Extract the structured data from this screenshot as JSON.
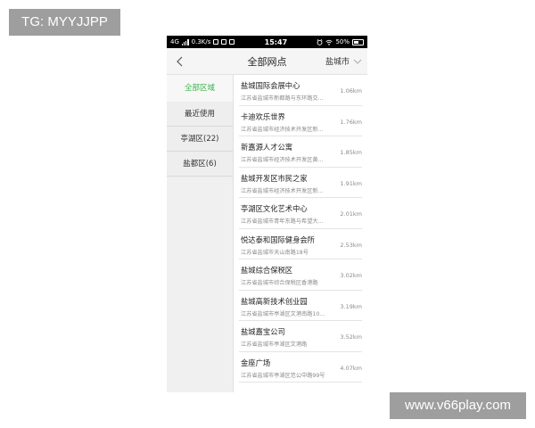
{
  "watermarks": {
    "top": "TG: MYYJJPP",
    "bottom": "www.v66play.com"
  },
  "statusbar": {
    "network": "4G",
    "speed": "0.3K/s",
    "time": "15:47",
    "battery": "50%"
  },
  "navbar": {
    "title": "全部网点",
    "city": "盐城市"
  },
  "sidebar": {
    "items": [
      {
        "label": "全部区域"
      },
      {
        "label": "最近使用"
      },
      {
        "label": "亭湖区(22)"
      },
      {
        "label": "盐都区(6)"
      }
    ]
  },
  "list": {
    "rows": [
      {
        "name": "盐城国际会展中心",
        "address": "江苏省盐城市新都路与东环路交...",
        "distance": "1.06km"
      },
      {
        "name": "卡迪欢乐世界",
        "address": "江苏省盐城市经济技术开发区新...",
        "distance": "1.76km"
      },
      {
        "name": "新嘉源人才公寓",
        "address": "江苏省盐城市经济技术开发区黄...",
        "distance": "1.85km"
      },
      {
        "name": "盐城开发区市民之家",
        "address": "江苏省盐城市经济技术开发区新...",
        "distance": "1.91km"
      },
      {
        "name": "亭湖区文化艺术中心",
        "address": "江苏省盐城市青年东路与希望大...",
        "distance": "2.01km"
      },
      {
        "name": "悦达泰和国际健身会所",
        "address": "江苏省盐城市天山南路18号",
        "distance": "2.53km"
      },
      {
        "name": "盐城综合保税区",
        "address": "江苏省盐城市综合保税区香港路",
        "distance": "3.02km"
      },
      {
        "name": "盐城高新技术创业园",
        "address": "江苏省盐城市亭湖区文港南路10...",
        "distance": "3.19km"
      },
      {
        "name": "盐城嘉宝公司",
        "address": "江苏省盐城市亭湖区文港路",
        "distance": "3.52km"
      },
      {
        "name": "金座广场",
        "address": "江苏省盐城市亭湖区范公中路99号",
        "distance": "4.07km"
      }
    ]
  }
}
